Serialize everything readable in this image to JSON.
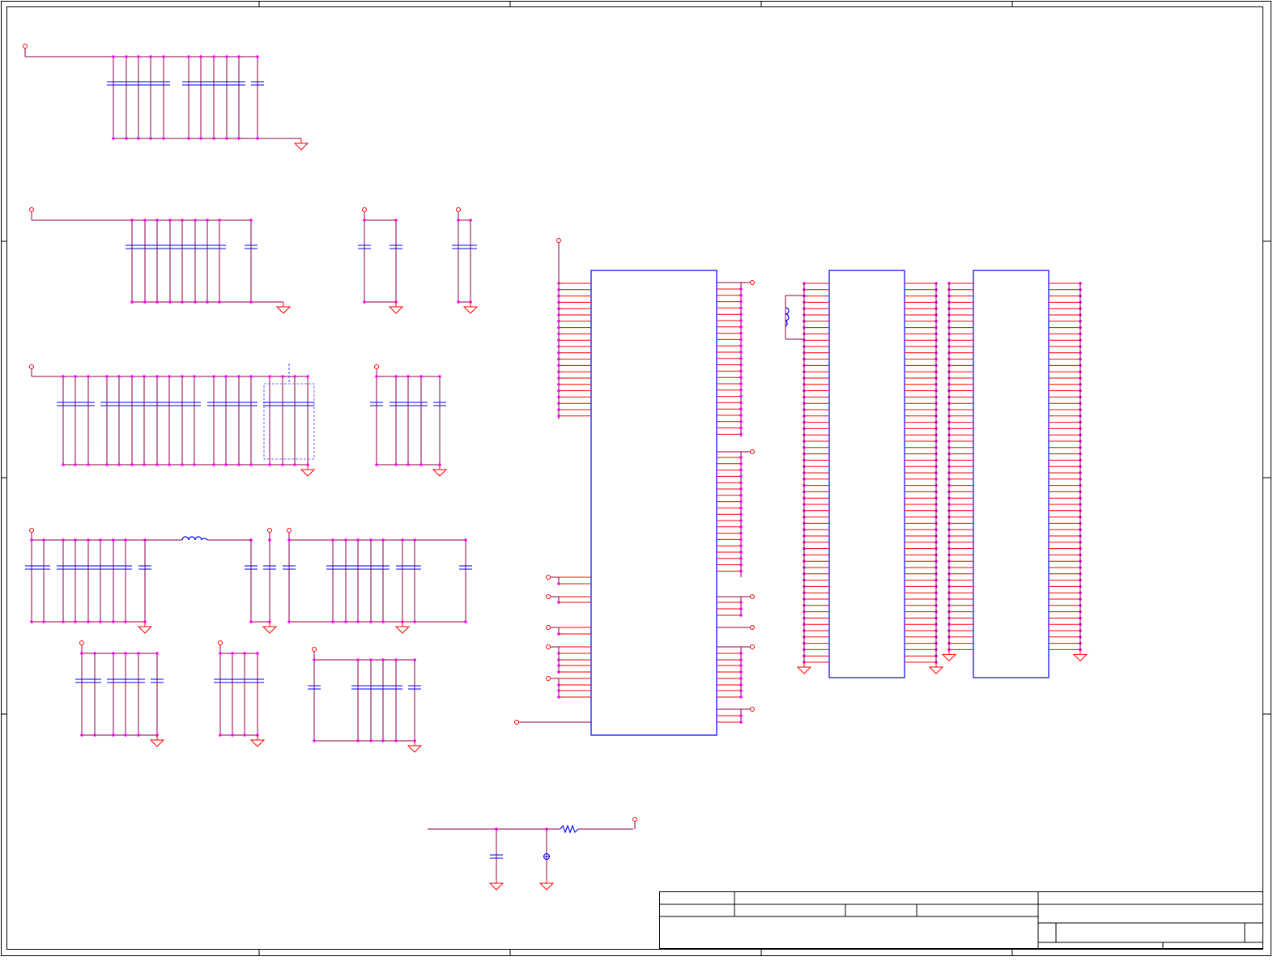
{
  "schematic": {
    "colors": {
      "wire": "#8b0045",
      "pin": "#ff0000",
      "junction": "#ff00ff",
      "part": "#0000ff",
      "frame": "#000000",
      "zone": "#4040ff"
    },
    "title_block": {
      "title": "",
      "sheet_label": "",
      "rev": "",
      "doc_number": "",
      "date": "",
      "sheet": ""
    },
    "border_zone_labels": []
  }
}
